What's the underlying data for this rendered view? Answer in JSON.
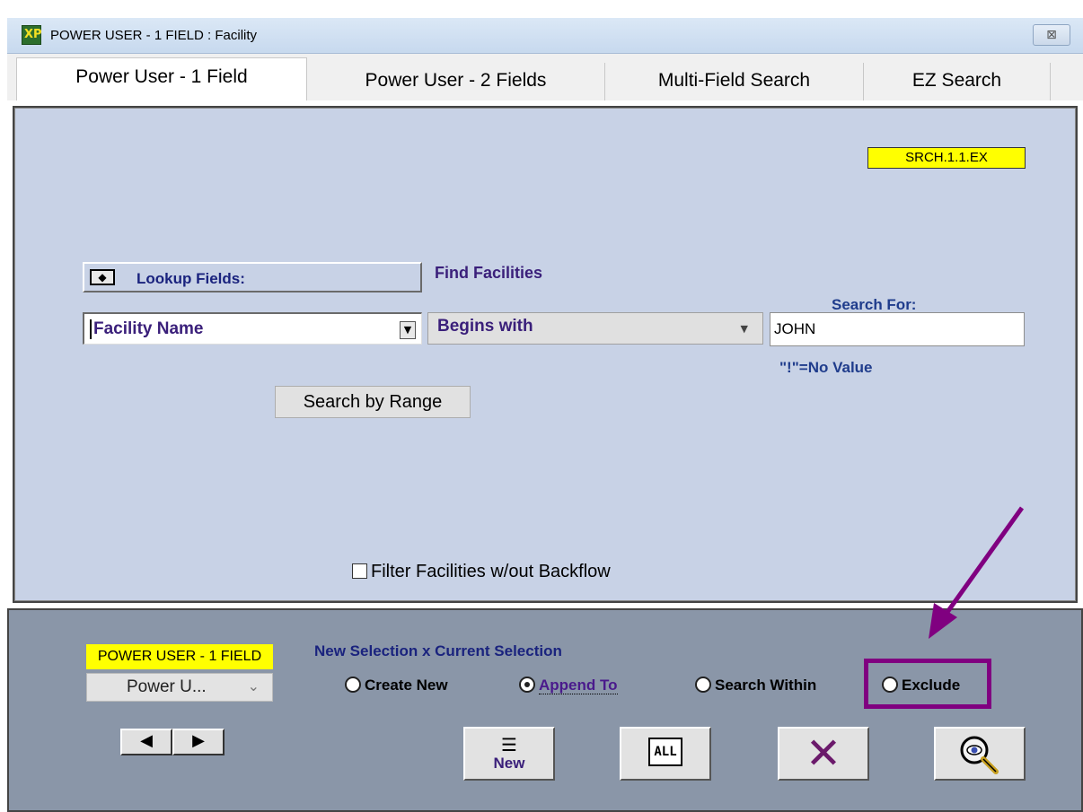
{
  "window": {
    "title": "POWER USER - 1 FIELD : Facility",
    "close_glyph": "⊠",
    "app_icon_text": "XP"
  },
  "tabs": [
    {
      "label": "Power User - 1 Field",
      "active": true
    },
    {
      "label": "Power User - 2 Fields",
      "active": false
    },
    {
      "label": "Multi-Field Search",
      "active": false
    },
    {
      "label": "EZ Search",
      "active": false
    }
  ],
  "main": {
    "badge": "SRCH.1.1.EX",
    "lookup_label": "Lookup Fields:",
    "find_label": "Find Facilities",
    "search_for_label": "Search For:",
    "field_value": "Facility Name",
    "operator_value": "Begins with",
    "search_value": "JOHN",
    "no_value_hint": "\"!\"=No Value",
    "range_button": "Search by Range",
    "filter_label": "Filter Facilities w/out Backflow",
    "filter_checked": false
  },
  "bottom": {
    "yellow_label": "POWER USER - 1 FIELD",
    "nav_select_value": "Power U...",
    "selection_heading": "New Selection x Current Selection",
    "radios": [
      {
        "label": "Create New",
        "selected": false
      },
      {
        "label": "Append To",
        "selected": true
      },
      {
        "label": "Search Within",
        "selected": false
      },
      {
        "label": "Exclude",
        "selected": false
      }
    ],
    "buttons": {
      "new_label": "New",
      "all_label": "ALL",
      "cancel_icon": "close-x-icon",
      "search_icon": "magnifier-icon"
    }
  },
  "colors": {
    "accent_purple": "#800080",
    "badge_yellow": "#ffff00",
    "panel_bg": "#c8d2e6",
    "bottom_bg": "#8a96a8"
  }
}
